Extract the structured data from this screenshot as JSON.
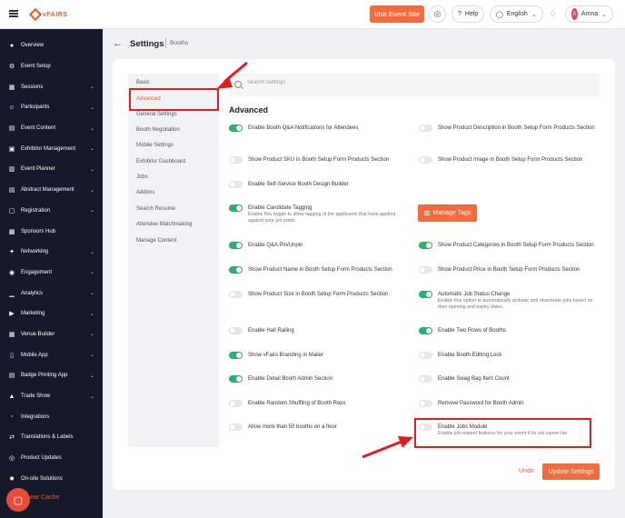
{
  "brand": {
    "name": "vFAIRS",
    "color": "#f15a24"
  },
  "topbar": {
    "event_button": "Visit Event Site",
    "help_label": "Help",
    "language": "English",
    "user_initial": "A",
    "user_name": "Amna"
  },
  "sidebar": {
    "items": [
      {
        "label": "Overview",
        "icon": "gauge-icon",
        "has_children": false
      },
      {
        "label": "Event Setup",
        "icon": "gear-icon",
        "has_children": false
      },
      {
        "label": "Sessions",
        "icon": "grid-icon",
        "has_children": true
      },
      {
        "label": "Participants",
        "icon": "users-icon",
        "has_children": true
      },
      {
        "label": "Event Content",
        "icon": "content-icon",
        "has_children": true
      },
      {
        "label": "Exhibitor Management",
        "icon": "booth-icon",
        "has_children": true
      },
      {
        "label": "Event Planner",
        "icon": "planner-icon",
        "has_children": true
      },
      {
        "label": "Abstract Management",
        "icon": "doc-icon",
        "has_children": true
      },
      {
        "label": "Registration",
        "icon": "badge-icon",
        "has_children": true
      },
      {
        "label": "Sponsors Hub",
        "icon": "sponsor-icon",
        "has_children": false
      },
      {
        "label": "Networking",
        "icon": "network-icon",
        "has_children": true
      },
      {
        "label": "Engagement",
        "icon": "engage-icon",
        "has_children": true
      },
      {
        "label": "Analytics",
        "icon": "chart-icon",
        "has_children": true
      },
      {
        "label": "Marketing",
        "icon": "megaphone-icon",
        "has_children": true
      },
      {
        "label": "Venue Builder",
        "icon": "venue-icon",
        "has_children": true
      },
      {
        "label": "Mobile App",
        "icon": "mobile-icon",
        "has_children": true
      },
      {
        "label": "Badge Printing App",
        "icon": "printer-icon",
        "has_children": true
      },
      {
        "label": "Trade Show",
        "icon": "tradeshow-icon",
        "has_children": true
      },
      {
        "label": "Integrations",
        "icon": "plug-icon",
        "has_children": false
      },
      {
        "label": "Translations & Labels",
        "icon": "translate-icon",
        "has_children": false
      },
      {
        "label": "Product Updates",
        "icon": "bell-icon",
        "has_children": false
      },
      {
        "label": "On-site Solutions",
        "icon": "onsite-icon",
        "has_children": false
      }
    ],
    "footer_text": "ear Cache"
  },
  "page": {
    "title": "Settings",
    "breadcrumb": "Booths"
  },
  "subnav": {
    "items": [
      "Basic",
      "Advanced",
      "General Settings",
      "Booth Negotiation",
      "Mobile Settings",
      "Exhibitor Dashboard",
      "Jobs",
      "Addons",
      "Search Resume",
      "Attendee Matchmaking",
      "Manage Content"
    ],
    "active": "Advanced"
  },
  "search": {
    "placeholder": "Search Settings"
  },
  "section_title": "Advanced",
  "settings": {
    "left": [
      {
        "label": "Enable Booth Q&A Notifications for Attendees",
        "on": true
      },
      {
        "label": "Show Product SKU in Booth Setup Form Products Section",
        "on": false
      },
      {
        "label": "Enable Self-Service Booth Design Builder",
        "on": false
      },
      {
        "label": "Enable Candidate Tagging",
        "desc": "Enable this toggle to allow tagging of the applicants that have applied against your job posts.",
        "on": true
      },
      {
        "label": "Enable Q&A Pin/Unpin",
        "on": true
      },
      {
        "label": "Show Product Name in Booth Setup Form Products Section",
        "on": true
      },
      {
        "label": "Show Product Size in Booth Setup Form Products Section",
        "on": false
      },
      {
        "label": "Enable Hall Railing",
        "on": false
      },
      {
        "label": "Show vFairs Branding in Mailer",
        "on": true
      },
      {
        "label": "Enable Detail Booth Admin Section",
        "on": true
      },
      {
        "label": "Enable Random Shuffling of Booth Reps",
        "on": false
      },
      {
        "label": "Allow more than 50 booths on a floor",
        "on": false
      }
    ],
    "right": [
      {
        "label": "Show Product Description in Booth Setup Form Products Section",
        "on": false
      },
      {
        "label": "Show Product Image in Booth Setup Form Products Section",
        "on": false
      },
      {
        "label": "Show Product Categories in Booth Setup Form Products Section",
        "on": true
      },
      {
        "label": "Show Product Price in Booth Setup Form Products Section",
        "on": false
      },
      {
        "label": "Automatic Job Status Change",
        "desc": "Enable this option to automatically activate and deactivate jobs based on their opening and expiry dates.",
        "on": true
      },
      {
        "label": "Enable Two Rows of Booths",
        "on": true
      },
      {
        "label": "Enable Booth Editing Lock",
        "on": false
      },
      {
        "label": "Enable Swag Bag Item Count",
        "on": false
      },
      {
        "label": "Remove Password for Booth Admin",
        "on": false
      },
      {
        "label": "Enable Jobs Module",
        "desc": "Enable job-related features for your event if its not career fair",
        "on": false
      }
    ]
  },
  "manage_tags_button": "Manage Tags",
  "footer": {
    "undo": "Undo",
    "update": "Update Settings"
  },
  "colors": {
    "accent": "#f26a3d",
    "toggle_on": "#2cb06a",
    "highlight": "#e01e1e",
    "sidebar_bg": "#16182b"
  }
}
